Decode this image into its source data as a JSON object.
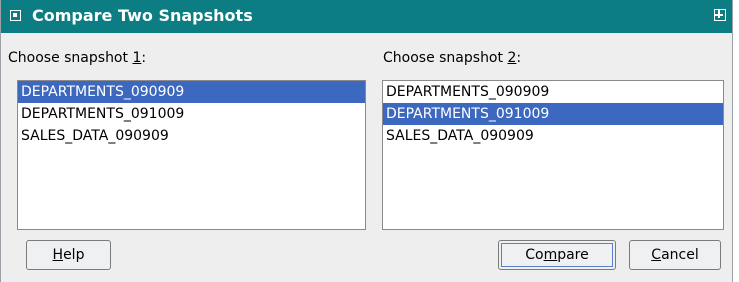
{
  "window": {
    "title": "Compare Two Snapshots"
  },
  "left": {
    "label_prefix": "Choose snapshot ",
    "label_mnemonic": "1",
    "label_suffix": ":",
    "items": [
      "DEPARTMENTS_090909",
      "DEPARTMENTS_091009",
      "SALES_DATA_090909"
    ],
    "selected": "DEPARTMENTS_090909"
  },
  "right": {
    "label_prefix": "Choose snapshot ",
    "label_mnemonic": "2",
    "label_suffix": ":",
    "items": [
      "DEPARTMENTS_090909",
      "DEPARTMENTS_091009",
      "SALES_DATA_090909"
    ],
    "selected": "DEPARTMENTS_091009"
  },
  "buttons": {
    "help_mnemonic": "H",
    "help_rest": "elp",
    "compare_pre": "Co",
    "compare_mnemonic": "m",
    "compare_rest": "pare",
    "cancel_mnemonic": "C",
    "cancel_rest": "ancel"
  },
  "colors": {
    "titlebar": "#0c7d82",
    "selection": "#3d68bf",
    "dialog_bg": "#eeeeee"
  },
  "icons": {
    "window_menu": "window-menu-icon",
    "maximize": "maximize-icon"
  }
}
